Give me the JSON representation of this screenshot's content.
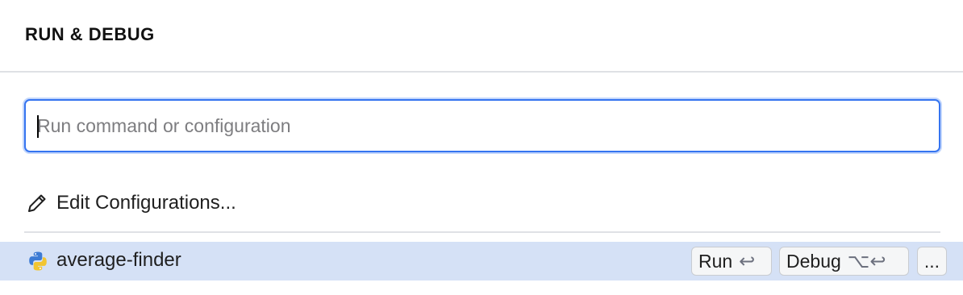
{
  "header": {
    "title": "RUN & DEBUG"
  },
  "search": {
    "placeholder": "Run command or configuration",
    "value": ""
  },
  "edit_configurations": {
    "icon": "pencil-icon",
    "label": "Edit Configurations..."
  },
  "configurations": [
    {
      "icon": "python-icon",
      "name": "average-finder",
      "selected": true,
      "run": {
        "label": "Run",
        "shortcut": "↩"
      },
      "debug": {
        "label": "Debug",
        "shortcut": "⌥↩"
      },
      "more_label": "..."
    }
  ],
  "colors": {
    "accent": "#3574f0",
    "selection": "#d5e1f6",
    "divider": "#dfe1e5"
  }
}
